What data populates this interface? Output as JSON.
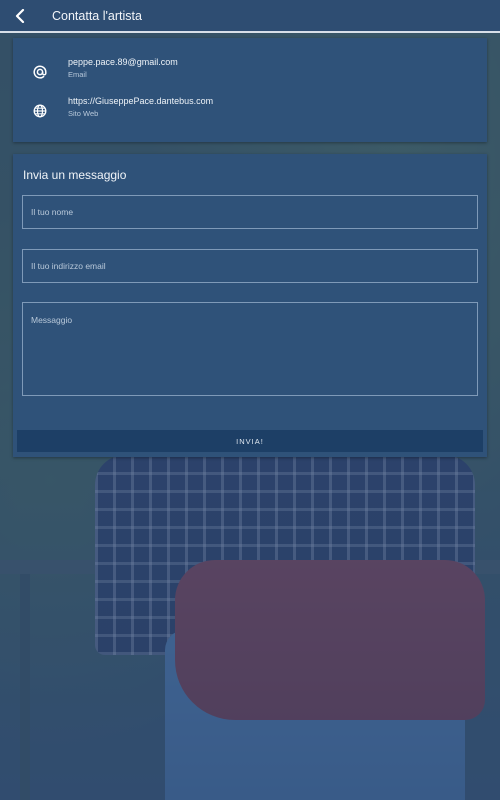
{
  "header": {
    "title": "Contatta l'artista",
    "back_icon": "chevron-left-icon"
  },
  "contact": {
    "email": {
      "value": "peppe.pace.89@gmail.com",
      "label": "Email",
      "icon": "at-sign-icon"
    },
    "website": {
      "value": "https://GiuseppePace.dantebus.com",
      "label": "Sito Web",
      "icon": "globe-icon"
    }
  },
  "form": {
    "title": "Invia un messaggio",
    "name_placeholder": "Il tuo nome",
    "email_placeholder": "Il tuo indirizzo email",
    "message_placeholder": "Messaggio",
    "send_label": "INVIA!"
  },
  "colors": {
    "header_bg": "#2e4d72",
    "card_bg": "#2f5279",
    "button_bg": "#1d3f66"
  }
}
